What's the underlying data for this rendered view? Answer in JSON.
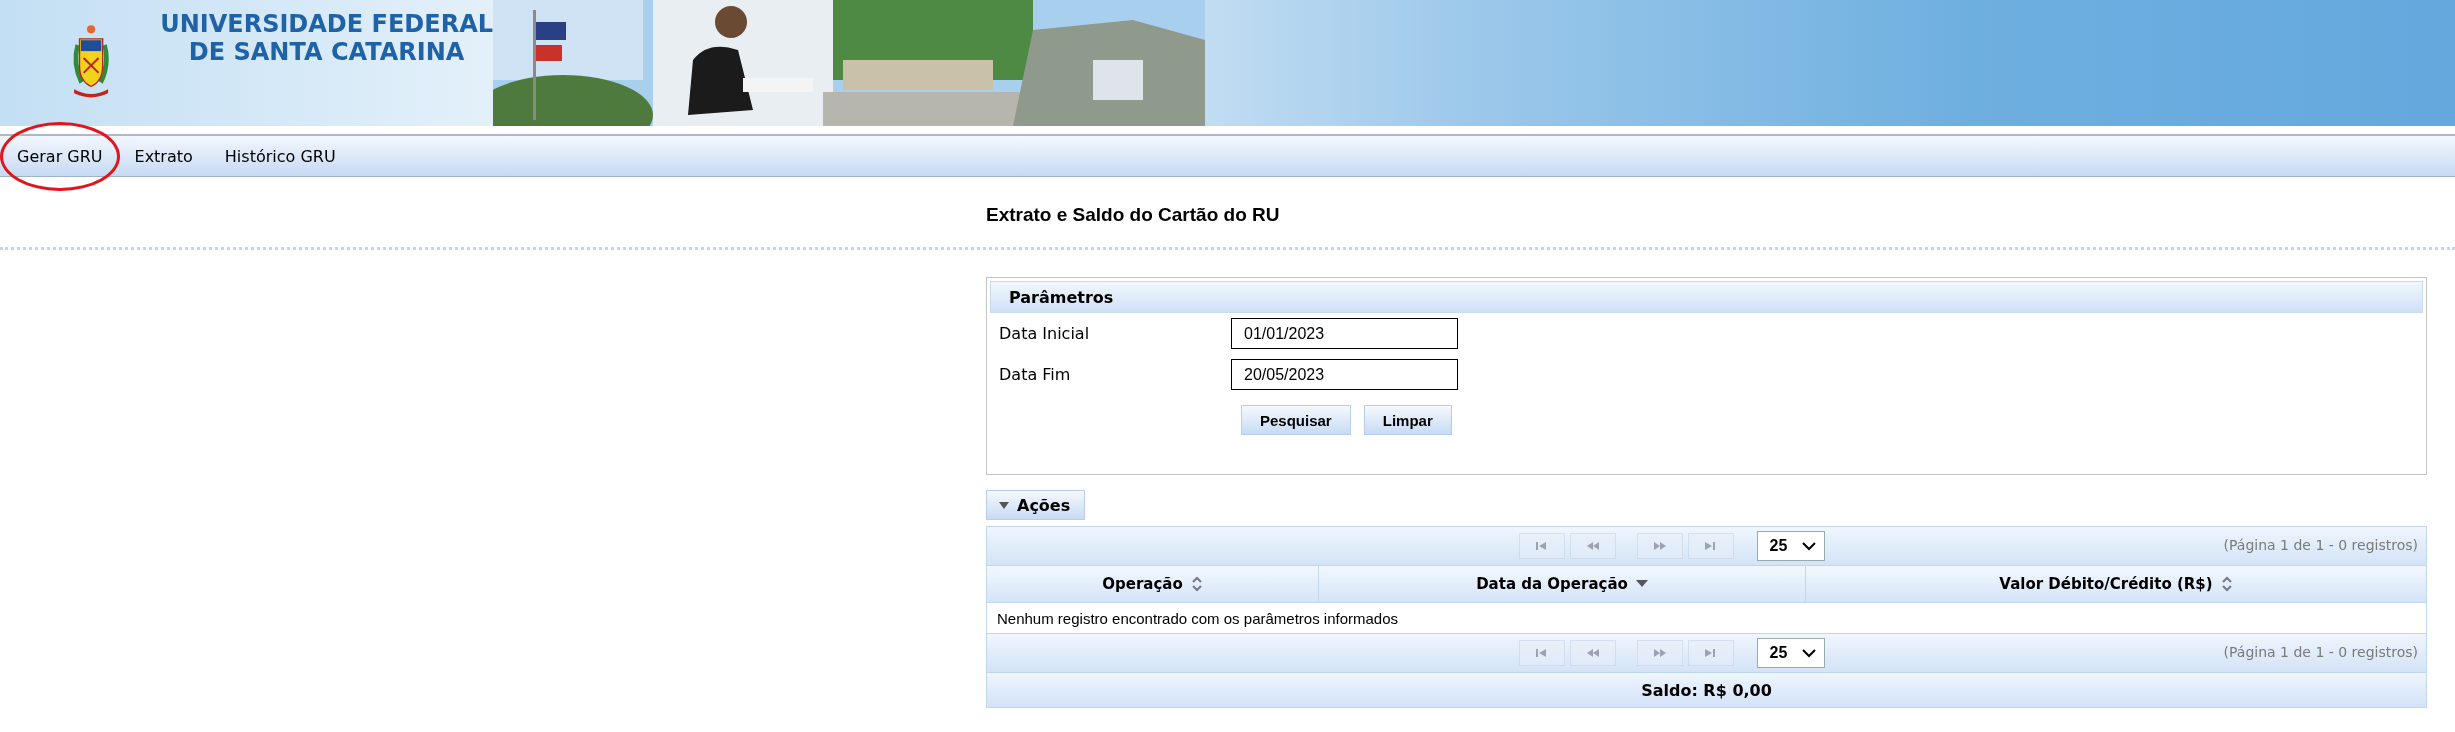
{
  "header": {
    "university_lines": [
      "UNIVERSIDADE FEDERAL",
      "DE SANTA CATARINA"
    ],
    "photo": {
      "kind": "picture"
    }
  },
  "menu": [
    {
      "label": "Gerar GRU",
      "highlighted": true
    },
    {
      "label": "Extrato",
      "highlighted": false
    },
    {
      "label": "Histórico GRU",
      "highlighted": false
    }
  ],
  "page_title": "Extrato e Saldo do Cartão do RU",
  "parameters": {
    "title": "Parâmetros",
    "fields": [
      {
        "label": "Data Inicial",
        "value": "01/01/2023"
      },
      {
        "label": "Data Fim",
        "value": "20/05/2023"
      }
    ],
    "buttons": [
      "Pesquisar",
      "Limpar"
    ]
  },
  "actions": {
    "label": "Ações",
    "expanded": false
  },
  "table": {
    "top_pager": {
      "buttons": [
        {
          "kind": "first",
          "disabled": true
        },
        {
          "kind": "prev",
          "disabled": true
        },
        {
          "kind": "next",
          "disabled": true
        },
        {
          "kind": "last",
          "disabled": true
        }
      ],
      "page_size": "25",
      "summary": "(Página 1 de 1 - 0 registros)"
    },
    "columns": [
      {
        "label": "Operação",
        "kind": "sortable"
      },
      {
        "label": "Data da Operação",
        "kind": "sorted"
      },
      {
        "label": "Valor Débito/Crédito (R$)",
        "kind": "sortable"
      }
    ],
    "empty_message": "Nenhum registro encontrado com os parâmetros informados",
    "bottom_pager": {
      "buttons": [
        {
          "kind": "first",
          "disabled": true
        },
        {
          "kind": "prev",
          "disabled": true
        },
        {
          "kind": "next",
          "disabled": true
        },
        {
          "kind": "last",
          "disabled": true
        }
      ],
      "page_size": "25",
      "summary": "(Página 1 de 1 - 0 registros)"
    },
    "footer": "Saldo: R$ 0,00"
  }
}
